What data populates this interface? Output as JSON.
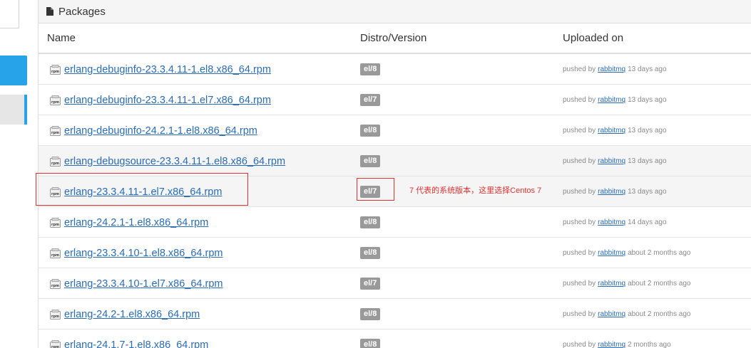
{
  "panel": {
    "title": "Packages",
    "columns": {
      "name": "Name",
      "distro": "Distro/Version",
      "uploaded": "Uploaded on"
    }
  },
  "packages": [
    {
      "name": "erlang-debuginfo-23.3.4.11-1.el8.x86_64.rpm",
      "distro": "el/8",
      "pushed_prefix": "pushed by",
      "user": "rabbitmq",
      "when": "13 days ago"
    },
    {
      "name": "erlang-debuginfo-23.3.4.11-1.el7.x86_64.rpm",
      "distro": "el/7",
      "pushed_prefix": "pushed by",
      "user": "rabbitmq",
      "when": "13 days ago"
    },
    {
      "name": "erlang-debuginfo-24.2.1-1.el8.x86_64.rpm",
      "distro": "el/8",
      "pushed_prefix": "pushed by",
      "user": "rabbitmq",
      "when": "13 days ago"
    },
    {
      "name": "erlang-debugsource-23.3.4.11-1.el8.x86_64.rpm",
      "distro": "el/8",
      "pushed_prefix": "pushed by",
      "user": "rabbitmq",
      "when": "13 days ago"
    },
    {
      "name": "erlang-23.3.4.11-1.el7.x86_64.rpm",
      "distro": "el/7",
      "pushed_prefix": "pushed by",
      "user": "rabbitmq",
      "when": "13 days ago"
    },
    {
      "name": "erlang-24.2.1-1.el8.x86_64.rpm",
      "distro": "el/8",
      "pushed_prefix": "pushed by",
      "user": "rabbitmq",
      "when": "14 days ago"
    },
    {
      "name": "erlang-23.3.4.10-1.el8.x86_64.rpm",
      "distro": "el/8",
      "pushed_prefix": "pushed by",
      "user": "rabbitmq",
      "when": "about 2 months ago"
    },
    {
      "name": "erlang-23.3.4.10-1.el7.x86_64.rpm",
      "distro": "el/7",
      "pushed_prefix": "pushed by",
      "user": "rabbitmq",
      "when": "about 2 months ago"
    },
    {
      "name": "erlang-24.2-1.el8.x86_64.rpm",
      "distro": "el/8",
      "pushed_prefix": "pushed by",
      "user": "rabbitmq",
      "when": "about 2 months ago"
    },
    {
      "name": "erlang-24.1.7-1.el8.x86_64.rpm",
      "distro": "el/8",
      "pushed_prefix": "pushed by",
      "user": "rabbitmq",
      "when": "2 months ago"
    }
  ],
  "annotation": {
    "note": "7 代表的系统版本，这里选择Centos 7",
    "color": "#e03030"
  },
  "colors": {
    "link": "#2a6cb5",
    "badge": "#999999",
    "sidebar_active": "#27a3ea"
  }
}
